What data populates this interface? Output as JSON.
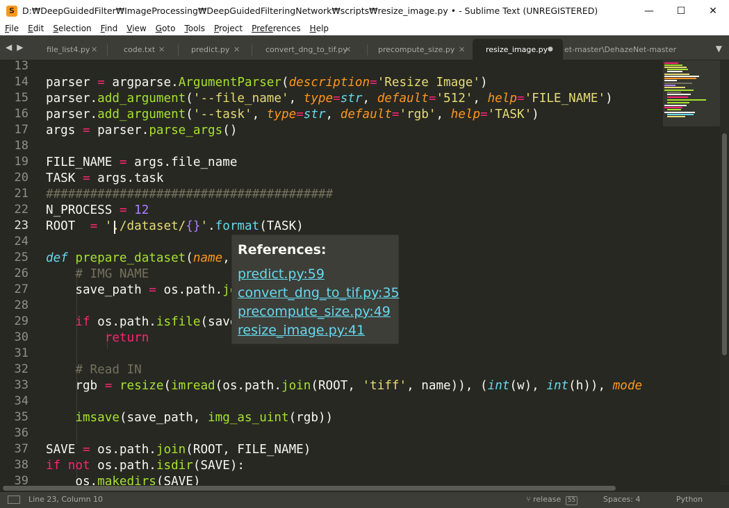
{
  "window": {
    "title": "D:₩DeepGuidedFilter₩ImageProcessing₩DeepGuidedFilteringNetwork₩scripts₩resize_image.py • - Sublime Text (UNREGISTERED)",
    "app_icon_letter": "S",
    "minimize": "—",
    "maximize": "☐",
    "close": "✕"
  },
  "menu": [
    {
      "u": "F",
      "rest": "ile"
    },
    {
      "u": "E",
      "rest": "dit"
    },
    {
      "u": "S",
      "rest": "election"
    },
    {
      "u": "F",
      "rest": "ind"
    },
    {
      "u": "V",
      "rest": "iew"
    },
    {
      "u": "G",
      "rest": "oto"
    },
    {
      "u": "T",
      "rest": "ools"
    },
    {
      "u": "P",
      "rest": "roject"
    },
    {
      "u": "Prefe",
      "rest": "rences"
    },
    {
      "u": "H",
      "rest": "elp"
    }
  ],
  "tabs": [
    {
      "label": "file_list4.py",
      "close": "✕"
    },
    {
      "label": "code.txt",
      "close": "✕"
    },
    {
      "label": "predict.py",
      "close": "✕"
    },
    {
      "label": "convert_dng_to_tif.py",
      "close": "✕"
    },
    {
      "label": "precompute_size.py",
      "close": "✕"
    },
    {
      "label": "resize_image.py",
      "close": "●"
    },
    {
      "label": "et-master\\DehazeNet-master"
    }
  ],
  "nav": {
    "back": "◀",
    "forward": "▶",
    "overflow": "▼"
  },
  "line_numbers": [
    "13",
    "14",
    "15",
    "16",
    "17",
    "18",
    "19",
    "20",
    "21",
    "22",
    "23",
    "24",
    "25",
    "26",
    "27",
    "28",
    "29",
    "30",
    "31",
    "32",
    "33",
    "34",
    "35",
    "36",
    "37",
    "38",
    "39"
  ],
  "current_line": "23",
  "code_colors": {
    "keyword": "#f92672",
    "function": "#a6e22e",
    "string": "#e6db74",
    "number": "#ae81ff",
    "comment": "#75715e",
    "argument": "#fd971f",
    "type": "#66d9ef"
  },
  "popup": {
    "title": "References:",
    "links": [
      "predict.py:59",
      "convert_dng_to_tif.py:35",
      "precompute_size.py:49",
      "resize_image.py:41"
    ]
  },
  "status": {
    "position": "Line 23, Column 10",
    "branch": "release",
    "branch_badge": "55",
    "spaces": "Spaces: 4",
    "syntax": "Python"
  }
}
